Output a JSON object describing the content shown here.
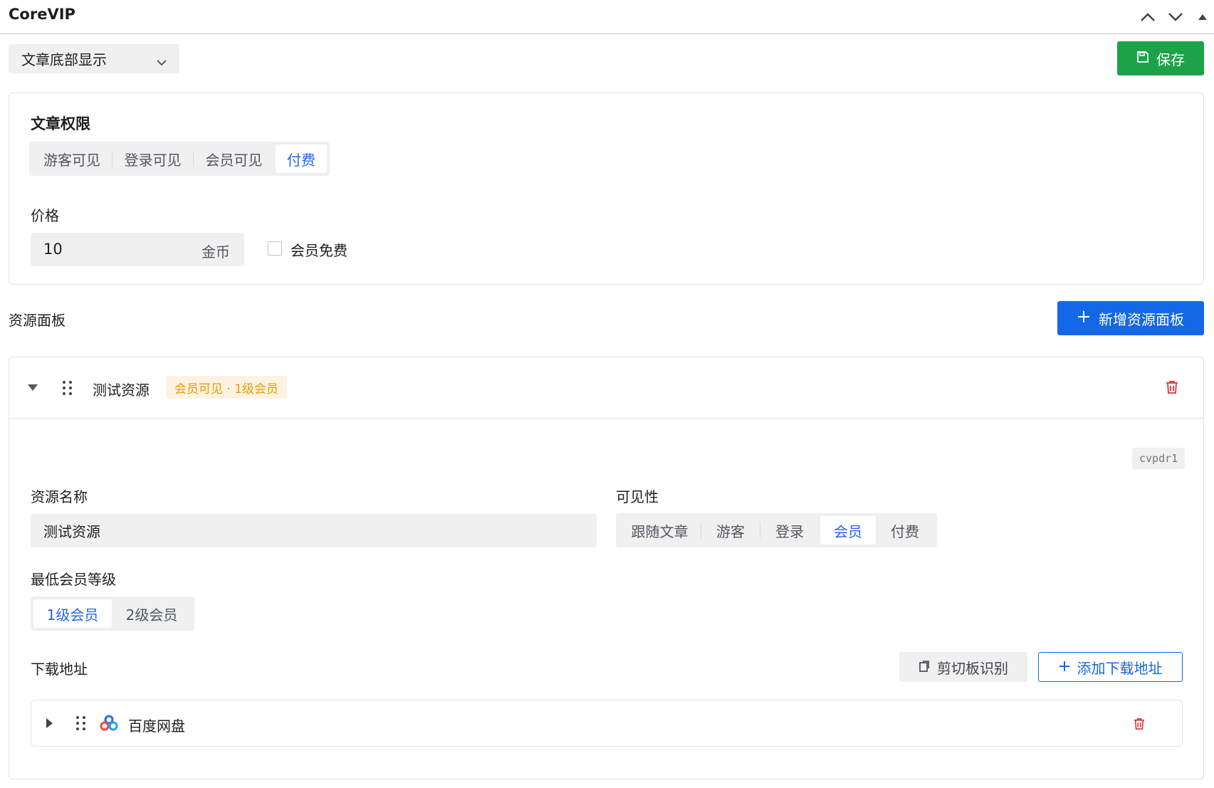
{
  "header": {
    "title": "CoreVIP",
    "controls": [
      "chevron-up-icon",
      "chevron-down-icon",
      "triangle-up-icon"
    ]
  },
  "position_select": {
    "value": "文章底部显示"
  },
  "save_button": {
    "label": "保存",
    "color": "#1ca34a"
  },
  "article_permission": {
    "heading": "文章权限",
    "options": [
      "游客可见",
      "登录可见",
      "会员可见",
      "付费"
    ],
    "selected": "付费",
    "price_label": "价格",
    "price_value": "10",
    "price_unit": "金币",
    "member_free_label": "会员免费",
    "member_free_checked": false
  },
  "resource_section": {
    "label": "资源面板",
    "add_button_label": "新增资源面板",
    "add_button_color": "#1467e6"
  },
  "resource": {
    "name": "测试资源",
    "badge": "会员可见 · 1级会员",
    "code": "cvpdr1",
    "name_label": "资源名称",
    "name_value": "测试资源",
    "visibility_label": "可见性",
    "visibility_options": [
      "跟随文章",
      "游客",
      "登录",
      "会员",
      "付费"
    ],
    "visibility_selected": "会员",
    "level_label": "最低会员等级",
    "level_options": [
      "1级会员",
      "2级会员"
    ],
    "level_selected": "1级会员",
    "download_label": "下载地址",
    "clipboard_button": "剪切板识别",
    "add_download_button": "添加下载地址",
    "downloads": [
      {
        "name": "百度网盘",
        "icon": "baidu-netdisk-icon"
      }
    ]
  },
  "colors": {
    "accent_blue": "#2563eb",
    "delete_red": "#d63638",
    "badge_orange": "#e39a0e"
  }
}
